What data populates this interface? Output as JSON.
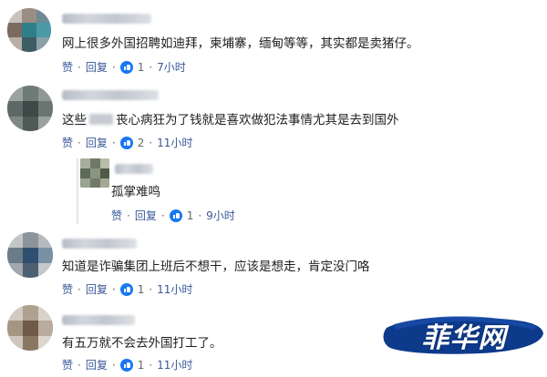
{
  "labels": {
    "like": "赞",
    "reply": "回复",
    "dot": "·"
  },
  "colors": {
    "like_blue": "#1877f2",
    "link": "#385898",
    "meta": "#65676b",
    "watermark_bg": "#0e3a8c"
  },
  "comments": [
    {
      "text": "网上很多外国招聘如迪拜，柬埔寨，缅甸等等，其实都是卖猪仔。",
      "reactions": "1",
      "time": "7小时"
    },
    {
      "text_a": "这些",
      "text_b": "丧心病狂为了钱就是喜欢做犯法事情尤其是去到国外",
      "reactions": "2",
      "time": "11小时"
    },
    {
      "text": "孤掌难鸣",
      "reactions": "1",
      "time": "9小时"
    },
    {
      "text": "知道是诈骗集团上班后不想干，应该是想走，肯定没门咯",
      "reactions": "1",
      "time": "11小时"
    },
    {
      "text": "有五万就不会去外国打工了。",
      "reactions": "1",
      "time": "11小时"
    }
  ],
  "watermark": {
    "text": "菲华网"
  }
}
